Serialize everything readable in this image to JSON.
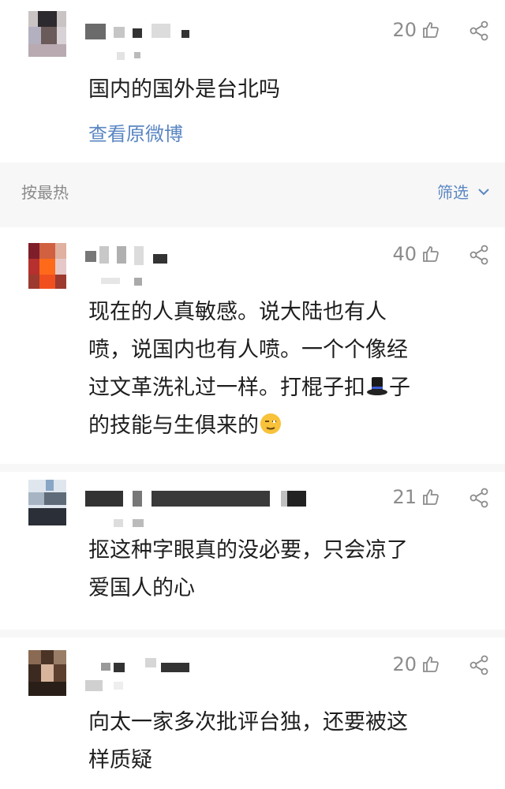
{
  "original_post": {
    "likes": "20",
    "text": "国内的国外是台北吗",
    "view_link": "查看原微博"
  },
  "sort_bar": {
    "sort_label": "按最热",
    "filter_label": "筛选"
  },
  "comments": [
    {
      "likes": "40",
      "line1": "现在的人真敏感。说大陆也有人",
      "line2": "喷，说国内也有人喷。一个个像经",
      "line3a": "过文革洗礼过一样。打棍子扣",
      "line3b": "子",
      "line4": "的技能与生俱来的"
    },
    {
      "likes": "21",
      "line1": "抠这种字眼真的没必要，只会凉了",
      "line2": "爱国人的心"
    },
    {
      "likes": "20",
      "line1": "向太一家多次批评台独，还要被这",
      "line2": "样质疑"
    }
  ],
  "icons": {
    "like": "thumbs-up-icon",
    "share": "share-icon",
    "hat_emoji": "top-hat-emoji",
    "face_emoji": "smirk-face-emoji",
    "chevron": "chevron-down-icon"
  },
  "colors": {
    "link": "#5a86c2",
    "muted": "#8c8c8c",
    "background": "#f7f7f7"
  }
}
